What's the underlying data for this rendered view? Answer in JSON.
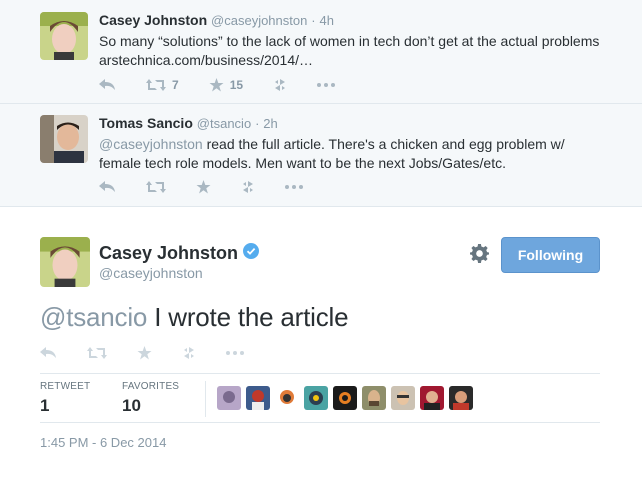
{
  "tweets": [
    {
      "name": "Casey Johnston",
      "handle": "@caseyjohnston",
      "sep": "·",
      "time": "4h",
      "text": "So many “solutions” to the lack of women in tech don’t get at the actual problems ",
      "link": "arstechnica.com/business/2014/…",
      "retweets": "7",
      "favorites": "15"
    },
    {
      "name": "Tomas Sancio",
      "handle": "@tsancio",
      "sep": "·",
      "time": "2h",
      "mention": "@caseyjohnston",
      "text": " read the full article. There's a chicken and egg problem w/ female tech role models. Men want to be the next Jobs/Gates/etc."
    }
  ],
  "main": {
    "name": "Casey Johnston",
    "handle": "@caseyjohnston",
    "follow_label": "Following",
    "mention": "@tsancio",
    "text": " I wrote the article",
    "retweet_label": "RETWEET",
    "retweet_count": "1",
    "favorites_label": "FAVORITES",
    "favorites_count": "10",
    "timestamp": "1:45 PM - 6 Dec 2014"
  },
  "colors": {
    "accent": "#6ea6dd",
    "muted": "#8899a6",
    "icon": "#aab8c2",
    "verified": "#55acee"
  },
  "icons": [
    "reply-icon",
    "retweet-icon",
    "favorite-icon",
    "buffer-icon",
    "more-icon",
    "gear-icon",
    "verified-icon"
  ]
}
